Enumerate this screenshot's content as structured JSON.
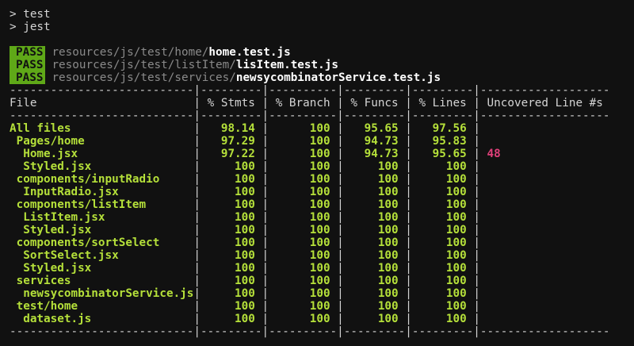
{
  "commands": [
    "> test",
    "> jest"
  ],
  "colors": {
    "pass_badge": "#5fa818",
    "covered": "#b5e03a",
    "uncovered": "#e0407a",
    "background": "#111111"
  },
  "results": [
    {
      "status": "PASS",
      "dir": "resources/js/test/home/",
      "file": "home.test.js"
    },
    {
      "status": "PASS",
      "dir": "resources/js/test/listItem/",
      "file": "lisItem.test.js"
    },
    {
      "status": "PASS",
      "dir": "resources/js/test/services/",
      "file": "newsycombinatorService.test.js"
    }
  ],
  "table": {
    "headers": [
      "File",
      "% Stmts",
      "% Branch",
      "% Funcs",
      "% Lines",
      "Uncovered Line #s"
    ],
    "rows": [
      {
        "file": "All files",
        "indent": 0,
        "stmts": "98.14",
        "branch": "100",
        "funcs": "95.65",
        "lines": "97.56",
        "uncovered": ""
      },
      {
        "file": "Pages/home",
        "indent": 1,
        "stmts": "97.29",
        "branch": "100",
        "funcs": "94.73",
        "lines": "95.83",
        "uncovered": ""
      },
      {
        "file": "Home.jsx",
        "indent": 2,
        "stmts": "97.22",
        "branch": "100",
        "funcs": "94.73",
        "lines": "95.65",
        "uncovered": "48"
      },
      {
        "file": "Styled.jsx",
        "indent": 2,
        "stmts": "100",
        "branch": "100",
        "funcs": "100",
        "lines": "100",
        "uncovered": ""
      },
      {
        "file": "components/inputRadio",
        "indent": 1,
        "stmts": "100",
        "branch": "100",
        "funcs": "100",
        "lines": "100",
        "uncovered": ""
      },
      {
        "file": "InputRadio.jsx",
        "indent": 2,
        "stmts": "100",
        "branch": "100",
        "funcs": "100",
        "lines": "100",
        "uncovered": ""
      },
      {
        "file": "components/listItem",
        "indent": 1,
        "stmts": "100",
        "branch": "100",
        "funcs": "100",
        "lines": "100",
        "uncovered": ""
      },
      {
        "file": "ListItem.jsx",
        "indent": 2,
        "stmts": "100",
        "branch": "100",
        "funcs": "100",
        "lines": "100",
        "uncovered": ""
      },
      {
        "file": "Styled.jsx",
        "indent": 2,
        "stmts": "100",
        "branch": "100",
        "funcs": "100",
        "lines": "100",
        "uncovered": ""
      },
      {
        "file": "components/sortSelect",
        "indent": 1,
        "stmts": "100",
        "branch": "100",
        "funcs": "100",
        "lines": "100",
        "uncovered": ""
      },
      {
        "file": "SortSelect.jsx",
        "indent": 2,
        "stmts": "100",
        "branch": "100",
        "funcs": "100",
        "lines": "100",
        "uncovered": ""
      },
      {
        "file": "Styled.jsx",
        "indent": 2,
        "stmts": "100",
        "branch": "100",
        "funcs": "100",
        "lines": "100",
        "uncovered": ""
      },
      {
        "file": "services",
        "indent": 1,
        "stmts": "100",
        "branch": "100",
        "funcs": "100",
        "lines": "100",
        "uncovered": ""
      },
      {
        "file": "newsycombinatorService.js",
        "indent": 2,
        "stmts": "100",
        "branch": "100",
        "funcs": "100",
        "lines": "100",
        "uncovered": ""
      },
      {
        "file": "test/home",
        "indent": 1,
        "stmts": "100",
        "branch": "100",
        "funcs": "100",
        "lines": "100",
        "uncovered": ""
      },
      {
        "file": "dataset.js",
        "indent": 2,
        "stmts": "100",
        "branch": "100",
        "funcs": "100",
        "lines": "100",
        "uncovered": ""
      }
    ]
  }
}
